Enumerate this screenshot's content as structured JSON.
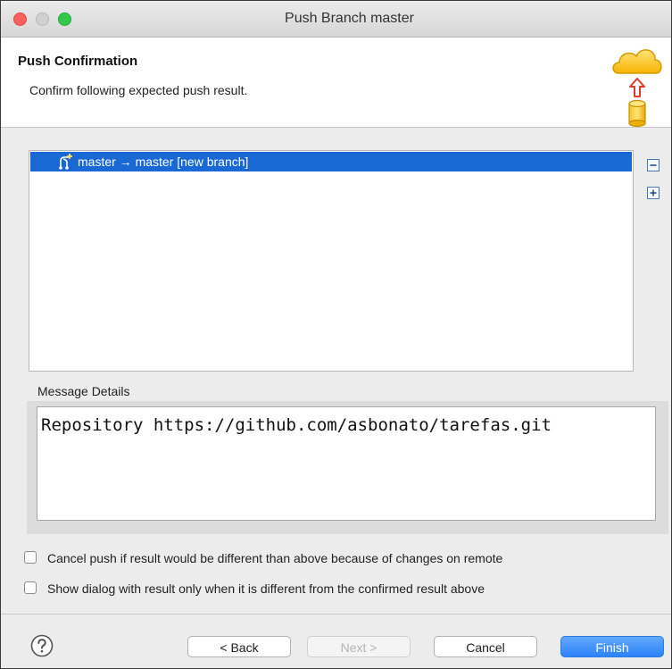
{
  "window": {
    "title": "Push Branch master"
  },
  "header": {
    "title": "Push Confirmation",
    "description": "Confirm following expected push result.",
    "icon": "cloud-push-icon"
  },
  "results": {
    "rows": [
      {
        "icon": "branch-icon",
        "label": "master → master [new branch]",
        "selected": true
      }
    ],
    "collapse_icon": "collapse-all-icon",
    "expand_icon": "expand-all-icon"
  },
  "message": {
    "label": "Message Details",
    "text": "Repository https://github.com/asbonato/tarefas.git"
  },
  "options": {
    "cancel_if_different": {
      "label": "Cancel push if result would be different than above because of changes on remote",
      "checked": false
    },
    "show_only_when_different": {
      "label": "Show dialog with result only when it is different from the confirmed result above",
      "checked": false
    }
  },
  "buttons": {
    "help_icon": "help-icon",
    "back": "< Back",
    "next": "Next >",
    "cancel": "Cancel",
    "finish": "Finish"
  },
  "colors": {
    "selection": "#1a68d4",
    "finish_button": "#2c82f8",
    "close_button": "#fc605c",
    "maximize_button": "#34c84a"
  }
}
